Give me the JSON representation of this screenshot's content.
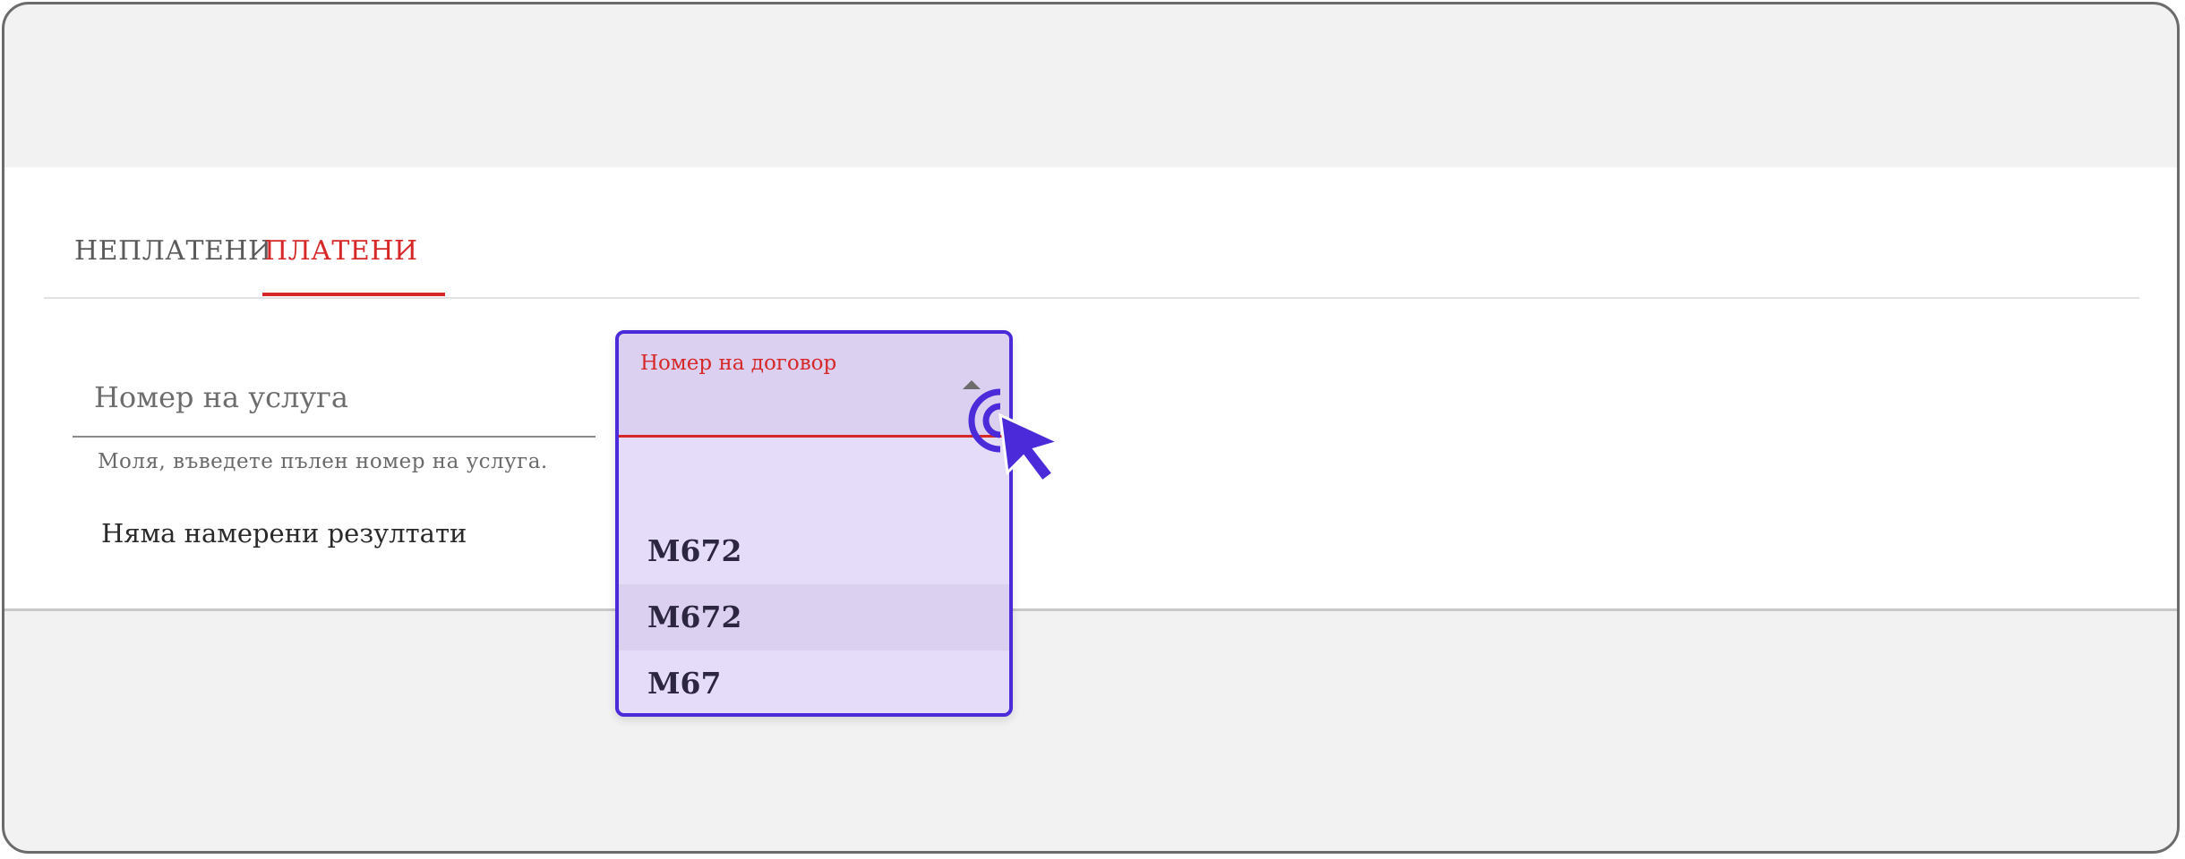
{
  "tabs": [
    {
      "label": "НЕПЛАТЕНИ"
    },
    {
      "label": "ПЛАТЕНИ"
    }
  ],
  "service": {
    "label": "Номер на услуга",
    "hint": "Моля, въведете пълен номер на услуга.",
    "no_results": "Няма намерени резултати"
  },
  "contract_dropdown": {
    "label": "Номер на договор",
    "options": [
      "М672",
      "М672",
      "М67"
    ]
  },
  "colors": {
    "accent": "#d62828",
    "cursor": "#4b2bd9",
    "dropdown_bg": "#e5dcfa"
  }
}
